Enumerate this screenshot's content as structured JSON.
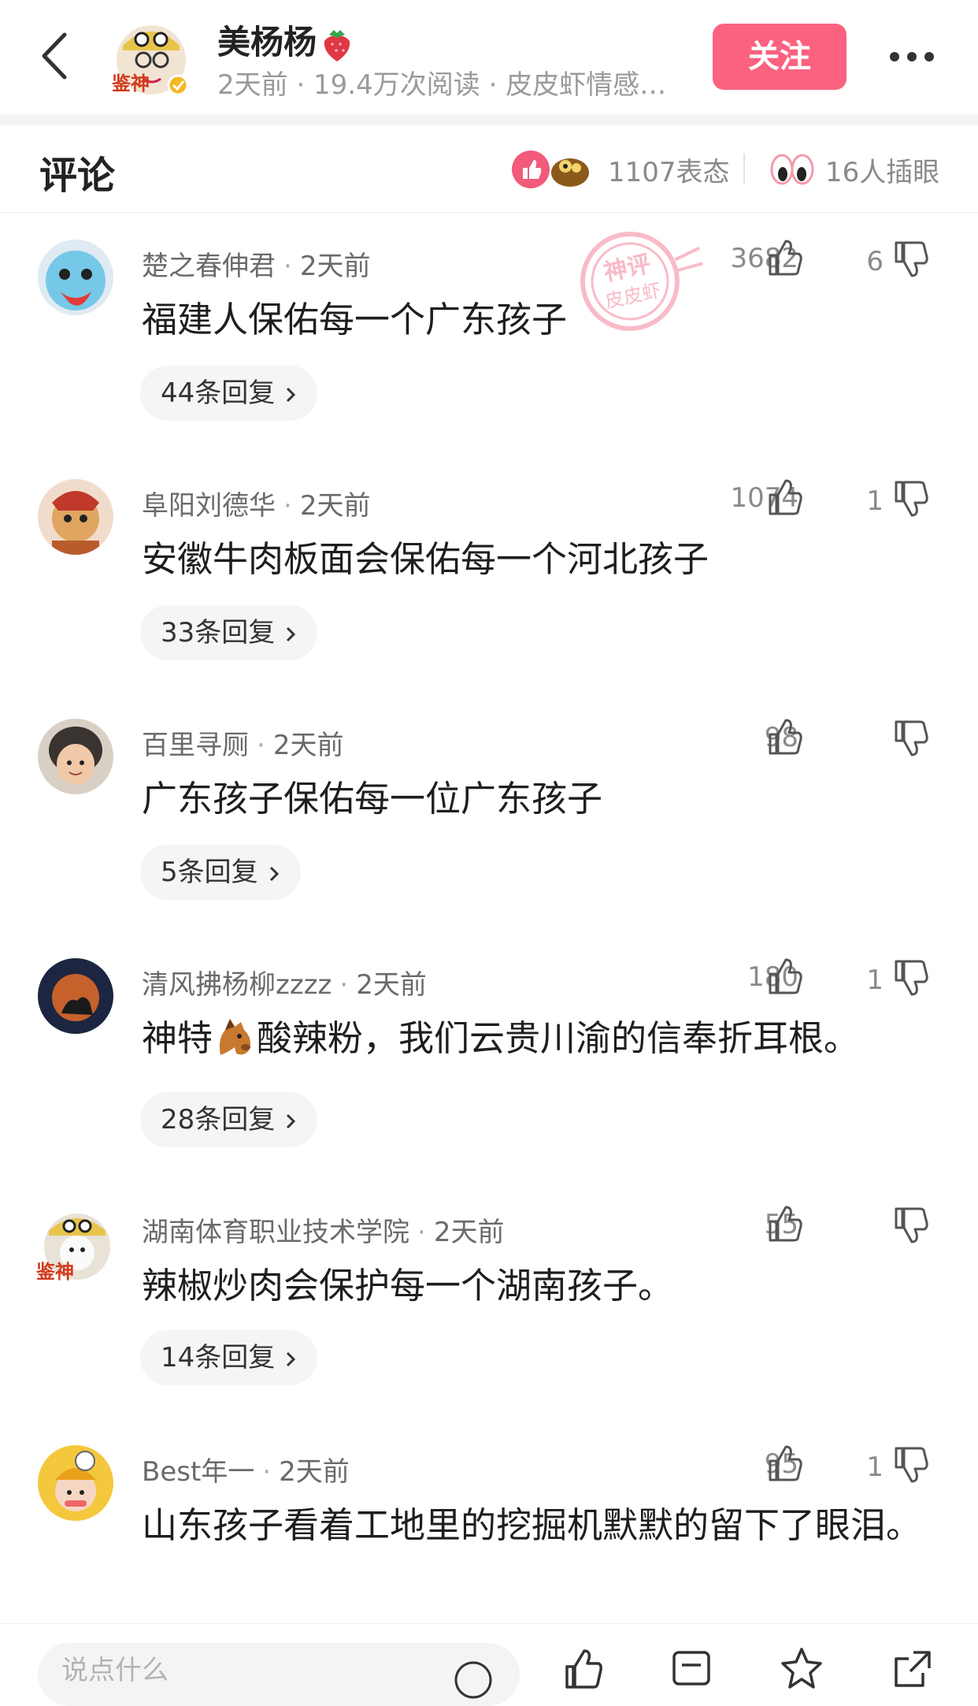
{
  "header": {
    "author_name": "美杨杨",
    "author_meta": "2天前 · 19.4万次阅读 · 皮皮虾情感…",
    "follow_label": "关注",
    "avatar_badge": "鉴神"
  },
  "comment_bar": {
    "title": "评论",
    "reaction_count": "1107表态",
    "watch_count": "16人插眼"
  },
  "watermark": {
    "line1": "神评",
    "line2": "皮皮虾"
  },
  "comments": [
    {
      "user": "楚之春伸君",
      "time": "2天前",
      "likes": "3682",
      "dislikes": "6",
      "text": "福建人保佑每一个广东孩子",
      "replies": "44条回复"
    },
    {
      "user": "阜阳刘德华",
      "time": "2天前",
      "likes": "1074",
      "dislikes": "1",
      "text": "安徽牛肉板面会保佑每一个河北孩子",
      "replies": "33条回复"
    },
    {
      "user": "百里寻厕",
      "time": "2天前",
      "likes": "98",
      "dislikes": "",
      "text": "广东孩子保佑每一位广东孩子",
      "replies": "5条回复"
    },
    {
      "user": "清风拂杨柳zzzz",
      "time": "2天前",
      "likes": "180",
      "dislikes": "1",
      "text_before": "神特",
      "text_after": "酸辣粉，我们云贵川渝的信奉折耳根。",
      "replies": "28条回复"
    },
    {
      "user": "湖南体育职业技术学院",
      "time": "2天前",
      "likes": "55",
      "dislikes": "",
      "text": "辣椒炒肉会保护每一个湖南孩子。",
      "replies": "14条回复",
      "avatar_badge": "鉴神"
    },
    {
      "user": "Best年一",
      "time": "2天前",
      "likes": "95",
      "dislikes": "1",
      "text": "山东孩子看着工地里的挖掘机默默的留下了眼泪。"
    }
  ],
  "bottom_bar": {
    "reply_placeholder": "说点什么"
  }
}
